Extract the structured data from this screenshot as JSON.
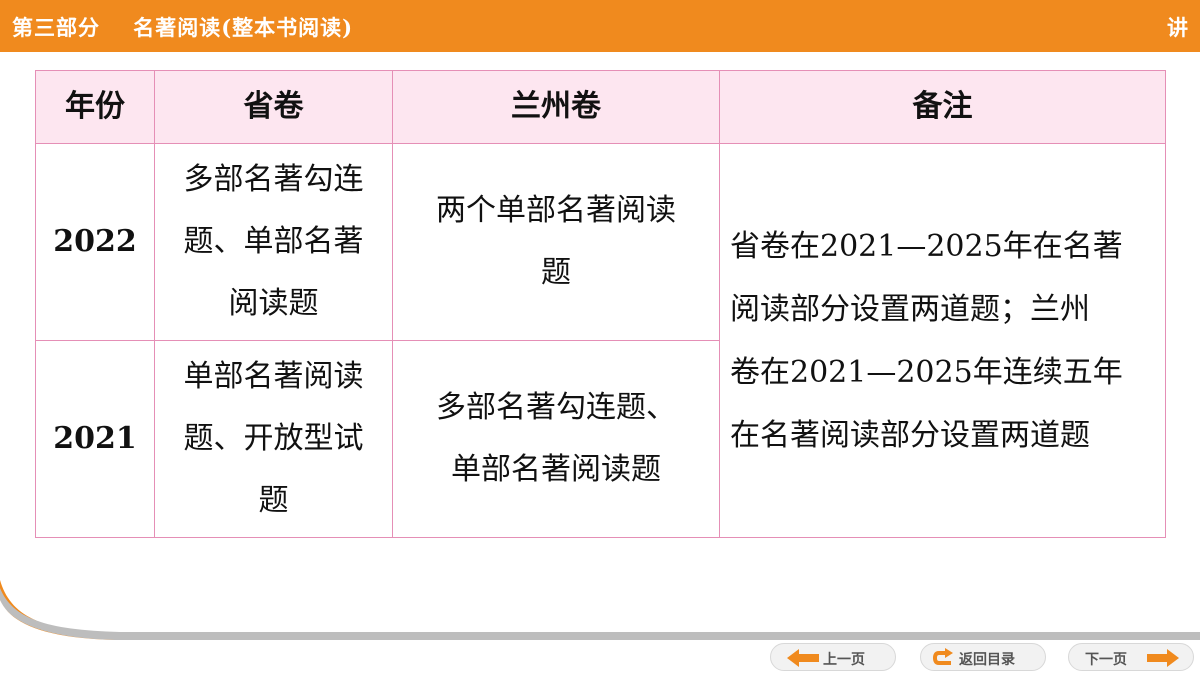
{
  "header": {
    "section": "第三部分",
    "topic": "名著阅读(整本书阅读)",
    "badge": "讲"
  },
  "table": {
    "headers": [
      "年份",
      "省卷",
      "兰州卷",
      "备注"
    ],
    "rows": [
      {
        "year": "2022",
        "provincial": [
          "多部名著勾连",
          "题、单部名著",
          "阅读题"
        ],
        "lanzhou": [
          "两个单部名著阅读",
          "题"
        ]
      },
      {
        "year": "2021",
        "provincial": [
          "单部名著阅读",
          "题、开放型试",
          "题"
        ],
        "lanzhou": [
          "多部名著勾连题、",
          "单部名著阅读题"
        ]
      }
    ],
    "note": [
      "省卷在2021—2025年在名著",
      "阅读部分设置两道题；兰州",
      "卷在2021—2025年连续五年",
      "在名著阅读部分设置两道题"
    ]
  },
  "nav": {
    "prev": "上一页",
    "back": "返回目录",
    "next": "下一页"
  },
  "colors": {
    "accent": "#F08A1E",
    "header_bg": "#FDE6F0",
    "border": "#E58FB6"
  }
}
